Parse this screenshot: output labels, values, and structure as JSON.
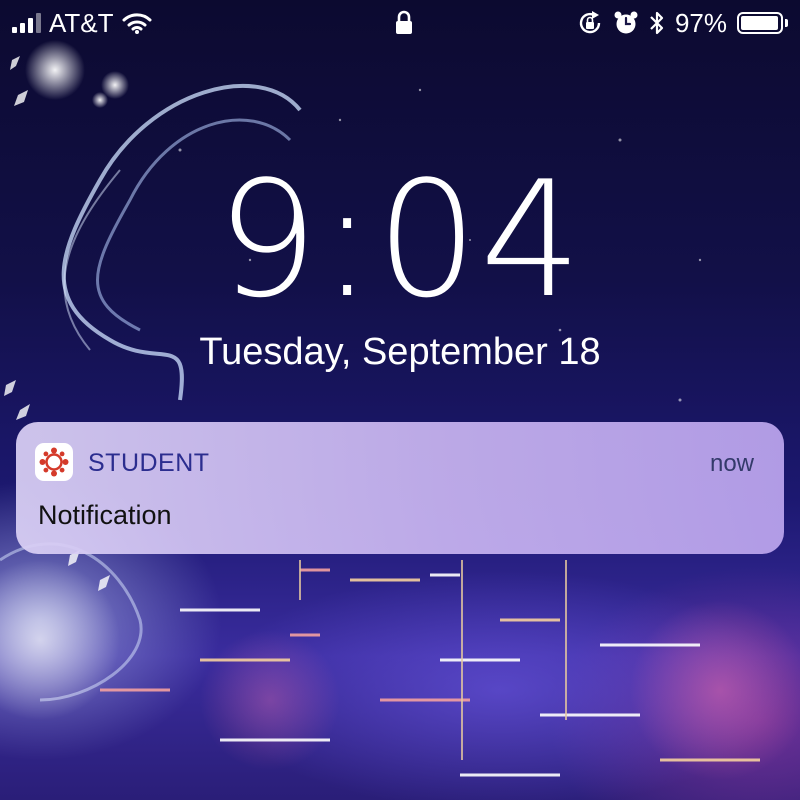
{
  "status_bar": {
    "carrier": "AT&T",
    "battery_percent": "97%",
    "battery_level": 0.97,
    "icons": [
      "signal-icon",
      "wifi-icon",
      "lock-icon",
      "orientation-lock-icon",
      "alarm-icon",
      "bluetooth-icon",
      "battery-icon"
    ]
  },
  "lock_screen": {
    "time": "9:04",
    "date": "Tuesday, September 18"
  },
  "notification": {
    "app_name": "STUDENT",
    "time": "now",
    "body": "Notification",
    "app_icon": "canvas-student-icon",
    "accent_color": "#d43a2a"
  }
}
